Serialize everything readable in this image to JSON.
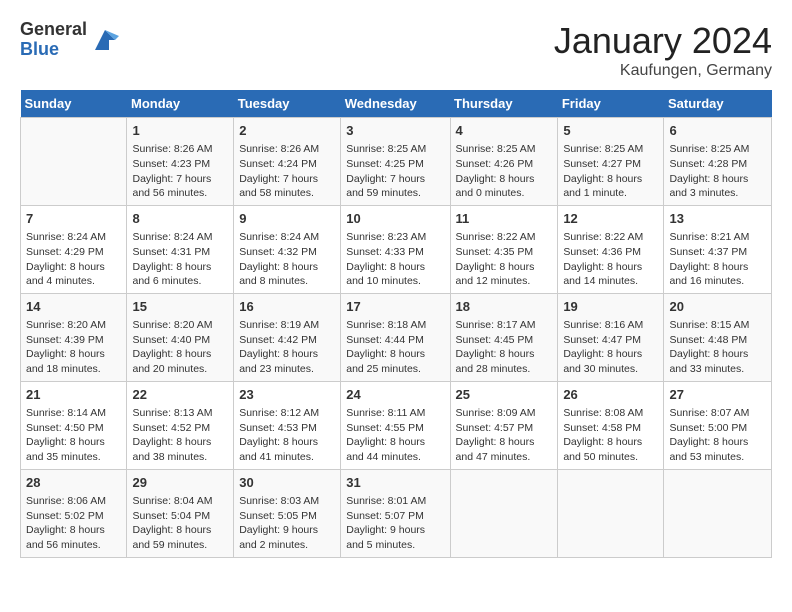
{
  "header": {
    "logo_general": "General",
    "logo_blue": "Blue",
    "month_title": "January 2024",
    "subtitle": "Kaufungen, Germany"
  },
  "days_of_week": [
    "Sunday",
    "Monday",
    "Tuesday",
    "Wednesday",
    "Thursday",
    "Friday",
    "Saturday"
  ],
  "weeks": [
    [
      {
        "day": "",
        "content": ""
      },
      {
        "day": "1",
        "content": "Sunrise: 8:26 AM\nSunset: 4:23 PM\nDaylight: 7 hours\nand 56 minutes."
      },
      {
        "day": "2",
        "content": "Sunrise: 8:26 AM\nSunset: 4:24 PM\nDaylight: 7 hours\nand 58 minutes."
      },
      {
        "day": "3",
        "content": "Sunrise: 8:25 AM\nSunset: 4:25 PM\nDaylight: 7 hours\nand 59 minutes."
      },
      {
        "day": "4",
        "content": "Sunrise: 8:25 AM\nSunset: 4:26 PM\nDaylight: 8 hours\nand 0 minutes."
      },
      {
        "day": "5",
        "content": "Sunrise: 8:25 AM\nSunset: 4:27 PM\nDaylight: 8 hours\nand 1 minute."
      },
      {
        "day": "6",
        "content": "Sunrise: 8:25 AM\nSunset: 4:28 PM\nDaylight: 8 hours\nand 3 minutes."
      }
    ],
    [
      {
        "day": "7",
        "content": "Sunrise: 8:24 AM\nSunset: 4:29 PM\nDaylight: 8 hours\nand 4 minutes."
      },
      {
        "day": "8",
        "content": "Sunrise: 8:24 AM\nSunset: 4:31 PM\nDaylight: 8 hours\nand 6 minutes."
      },
      {
        "day": "9",
        "content": "Sunrise: 8:24 AM\nSunset: 4:32 PM\nDaylight: 8 hours\nand 8 minutes."
      },
      {
        "day": "10",
        "content": "Sunrise: 8:23 AM\nSunset: 4:33 PM\nDaylight: 8 hours\nand 10 minutes."
      },
      {
        "day": "11",
        "content": "Sunrise: 8:22 AM\nSunset: 4:35 PM\nDaylight: 8 hours\nand 12 minutes."
      },
      {
        "day": "12",
        "content": "Sunrise: 8:22 AM\nSunset: 4:36 PM\nDaylight: 8 hours\nand 14 minutes."
      },
      {
        "day": "13",
        "content": "Sunrise: 8:21 AM\nSunset: 4:37 PM\nDaylight: 8 hours\nand 16 minutes."
      }
    ],
    [
      {
        "day": "14",
        "content": "Sunrise: 8:20 AM\nSunset: 4:39 PM\nDaylight: 8 hours\nand 18 minutes."
      },
      {
        "day": "15",
        "content": "Sunrise: 8:20 AM\nSunset: 4:40 PM\nDaylight: 8 hours\nand 20 minutes."
      },
      {
        "day": "16",
        "content": "Sunrise: 8:19 AM\nSunset: 4:42 PM\nDaylight: 8 hours\nand 23 minutes."
      },
      {
        "day": "17",
        "content": "Sunrise: 8:18 AM\nSunset: 4:44 PM\nDaylight: 8 hours\nand 25 minutes."
      },
      {
        "day": "18",
        "content": "Sunrise: 8:17 AM\nSunset: 4:45 PM\nDaylight: 8 hours\nand 28 minutes."
      },
      {
        "day": "19",
        "content": "Sunrise: 8:16 AM\nSunset: 4:47 PM\nDaylight: 8 hours\nand 30 minutes."
      },
      {
        "day": "20",
        "content": "Sunrise: 8:15 AM\nSunset: 4:48 PM\nDaylight: 8 hours\nand 33 minutes."
      }
    ],
    [
      {
        "day": "21",
        "content": "Sunrise: 8:14 AM\nSunset: 4:50 PM\nDaylight: 8 hours\nand 35 minutes."
      },
      {
        "day": "22",
        "content": "Sunrise: 8:13 AM\nSunset: 4:52 PM\nDaylight: 8 hours\nand 38 minutes."
      },
      {
        "day": "23",
        "content": "Sunrise: 8:12 AM\nSunset: 4:53 PM\nDaylight: 8 hours\nand 41 minutes."
      },
      {
        "day": "24",
        "content": "Sunrise: 8:11 AM\nSunset: 4:55 PM\nDaylight: 8 hours\nand 44 minutes."
      },
      {
        "day": "25",
        "content": "Sunrise: 8:09 AM\nSunset: 4:57 PM\nDaylight: 8 hours\nand 47 minutes."
      },
      {
        "day": "26",
        "content": "Sunrise: 8:08 AM\nSunset: 4:58 PM\nDaylight: 8 hours\nand 50 minutes."
      },
      {
        "day": "27",
        "content": "Sunrise: 8:07 AM\nSunset: 5:00 PM\nDaylight: 8 hours\nand 53 minutes."
      }
    ],
    [
      {
        "day": "28",
        "content": "Sunrise: 8:06 AM\nSunset: 5:02 PM\nDaylight: 8 hours\nand 56 minutes."
      },
      {
        "day": "29",
        "content": "Sunrise: 8:04 AM\nSunset: 5:04 PM\nDaylight: 8 hours\nand 59 minutes."
      },
      {
        "day": "30",
        "content": "Sunrise: 8:03 AM\nSunset: 5:05 PM\nDaylight: 9 hours\nand 2 minutes."
      },
      {
        "day": "31",
        "content": "Sunrise: 8:01 AM\nSunset: 5:07 PM\nDaylight: 9 hours\nand 5 minutes."
      },
      {
        "day": "",
        "content": ""
      },
      {
        "day": "",
        "content": ""
      },
      {
        "day": "",
        "content": ""
      }
    ]
  ]
}
